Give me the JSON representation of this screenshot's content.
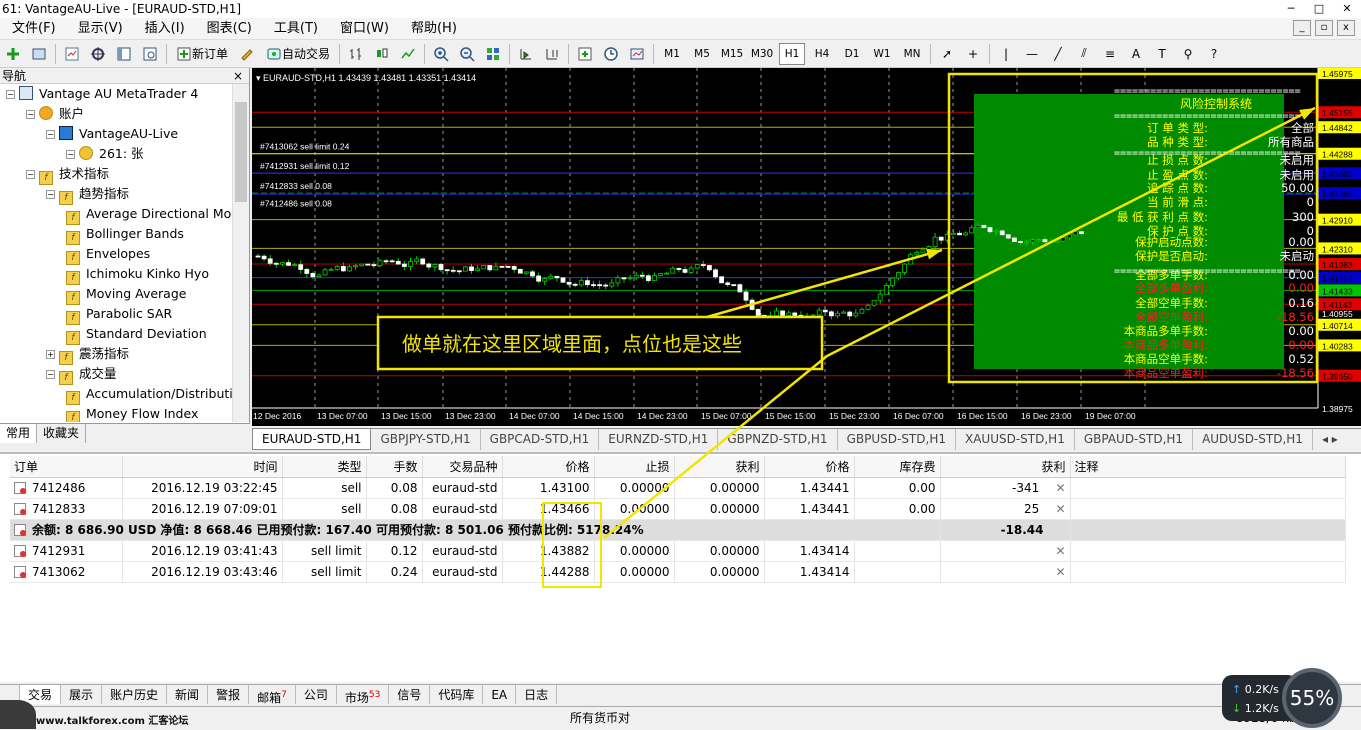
{
  "window": {
    "title": "61: VantageAU-Live - [EURAUD-STD,H1]"
  },
  "menu": [
    "文件(F)",
    "显示(V)",
    "插入(I)",
    "图表(C)",
    "工具(T)",
    "窗口(W)",
    "帮助(H)"
  ],
  "toolbar": {
    "new_order": "新订单",
    "auto_trading": "自动交易",
    "timeframes": [
      "M1",
      "M5",
      "M15",
      "M30",
      "H1",
      "H4",
      "D1",
      "W1",
      "MN"
    ],
    "active_tf": "H1"
  },
  "navigator": {
    "title": "导航",
    "tree": [
      {
        "level": 0,
        "label": "Vantage AU MetaTrader 4",
        "icon": "metatrader-icon"
      },
      {
        "level": 1,
        "label": "账户",
        "icon": "accounts-icon"
      },
      {
        "level": 2,
        "label": "VantageAU-Live",
        "icon": "server-icon"
      },
      {
        "level": 3,
        "label": "261: 张",
        "icon": "user-icon"
      },
      {
        "level": 1,
        "label": "技术指标",
        "icon": "indicator-icon"
      },
      {
        "level": 2,
        "label": "趋势指标",
        "icon": "indicator-icon"
      },
      {
        "level": 3,
        "label": "Average Directional Mo",
        "icon": "indicator-icon"
      },
      {
        "level": 3,
        "label": "Bollinger Bands",
        "icon": "indicator-icon"
      },
      {
        "level": 3,
        "label": "Envelopes",
        "icon": "indicator-icon"
      },
      {
        "level": 3,
        "label": "Ichimoku Kinko Hyo",
        "icon": "indicator-icon"
      },
      {
        "level": 3,
        "label": "Moving Average",
        "icon": "indicator-icon"
      },
      {
        "level": 3,
        "label": "Parabolic SAR",
        "icon": "indicator-icon"
      },
      {
        "level": 3,
        "label": "Standard Deviation",
        "icon": "indicator-icon"
      },
      {
        "level": 2,
        "label": "震荡指标",
        "icon": "indicator-icon"
      },
      {
        "level": 2,
        "label": "成交量",
        "icon": "indicator-icon"
      },
      {
        "level": 3,
        "label": "Accumulation/Distributic",
        "icon": "indicator-icon"
      },
      {
        "level": 3,
        "label": "Money Flow Index",
        "icon": "indicator-icon"
      }
    ],
    "tabs": [
      "常用",
      "收藏夹"
    ]
  },
  "chart": {
    "header": "EURAUD-STD,H1  1.43439 1.43481 1.43351 1.43414",
    "orders": [
      "#7413062 sell limit 0.24",
      "#7412931 sell limit 0.12",
      "#7412833 sell 0.08",
      "#7412486 sell 0.08"
    ],
    "x_labels": [
      "12 Dec 2016",
      "13 Dec 07:00",
      "13 Dec 15:00",
      "13 Dec 23:00",
      "14 Dec 07:00",
      "14 Dec 15:00",
      "14 Dec 23:00",
      "15 Dec 07:00",
      "15 Dec 15:00",
      "15 Dec 23:00",
      "16 Dec 07:00",
      "16 Dec 15:00",
      "16 Dec 23:00",
      "19 Dec 07:00"
    ],
    "price_labels": [
      {
        "text": "1.45155",
        "bg": "#e00000",
        "color": "#000"
      },
      {
        "text": "1.44842",
        "bg": "#ffff00",
        "color": "#000"
      },
      {
        "text": "1.44288",
        "bg": "#ffff00",
        "color": "#000"
      },
      {
        "text": "1.43882",
        "bg": "#0000cc",
        "color": "#000"
      },
      {
        "text": "1.43466",
        "bg": "#0000cc",
        "color": "#000"
      },
      {
        "text": "1.42910",
        "bg": "#ffff00",
        "color": "#000"
      },
      {
        "text": "1.42310",
        "bg": "#ffff00",
        "color": "#000"
      },
      {
        "text": "1.41983",
        "bg": "#e00000",
        "color": "#000"
      },
      {
        "text": "1.41414",
        "bg": "#0000cc",
        "color": "#000"
      },
      {
        "text": "1.41433",
        "bg": "#00c800",
        "color": "#000"
      },
      {
        "text": "1.41143",
        "bg": "#e00000",
        "color": "#000"
      },
      {
        "text": "1.40955",
        "bg": "#000",
        "color": "#fff"
      },
      {
        "text": "1.40714",
        "bg": "#ffff00",
        "color": "#000"
      },
      {
        "text": "1.40283",
        "bg": "#ffff00",
        "color": "#000"
      },
      {
        "text": "1.39650",
        "bg": "#e00000",
        "color": "#000"
      },
      {
        "text": "1.38975",
        "bg": "#000",
        "color": "#fff"
      },
      {
        "text": "1.45975",
        "bg": "#ffff00",
        "color": "#000"
      }
    ],
    "annotation": "做单就在这里区域里面，点位也是这些",
    "risk_panel": {
      "title": "风险控制系统",
      "rows": [
        {
          "label": "订 单 类 型:",
          "value": "全部",
          "color": "#ffff00"
        },
        {
          "label": "品 种 类 型:",
          "value": "所有商品",
          "color": "#ffff00"
        },
        {
          "label": "止 损 点 数:",
          "value": "未启用",
          "color": "#ffff00"
        },
        {
          "label": "止 盈 点 数:",
          "value": "未启用",
          "color": "#ffff00"
        },
        {
          "label": "追 踪 点 数:",
          "value": "50.00",
          "color": "#ffff00"
        },
        {
          "label": "当 前 滑 点:",
          "value": "0",
          "color": "#ffff00"
        },
        {
          "label": "最 低 获 利 点 数:",
          "value": "300",
          "color": "#ffff00"
        },
        {
          "label": "保 护 点 数:",
          "value": "0",
          "color": "#ffff00"
        },
        {
          "label": "保护启动点数:",
          "value": "0.00",
          "color": "#ffff00"
        },
        {
          "label": "保护是否启动:",
          "value": "未启动",
          "color": "#ffff00"
        },
        {
          "label": "全部多单手数:",
          "value": "0.00",
          "color": "#ffff00"
        },
        {
          "label": "全部多单盈利:",
          "value": "0.00",
          "color": "#ff2020"
        },
        {
          "label": "全部空单手数:",
          "value": "0.16",
          "color": "#ffff00"
        },
        {
          "label": "全部空单盈利:",
          "value": "-18.56",
          "color": "#ff2020"
        },
        {
          "label": "本商品多单手数:",
          "value": "0.00",
          "color": "#ffff00"
        },
        {
          "label": "本商品多单盈利:",
          "value": "0.00",
          "color": "#ff2020"
        },
        {
          "label": "本商品空单手数:",
          "value": "0.52",
          "color": "#ffff00"
        },
        {
          "label": "本商品空单盈利:",
          "value": "-18.56",
          "color": "#ff2020"
        }
      ]
    }
  },
  "chart_tabs": [
    "EURAUD-STD,H1",
    "GBPJPY-STD,H1",
    "GBPCAD-STD,H1",
    "EURNZD-STD,H1",
    "GBPNZD-STD,H1",
    "GBPUSD-STD,H1",
    "XAUUSD-STD,H1",
    "GBPAUD-STD,H1",
    "AUDUSD-STD,H1"
  ],
  "terminal": {
    "columns": [
      "订单",
      "时间",
      "类型",
      "手数",
      "交易品种",
      "价格",
      "止损",
      "获利",
      "价格",
      "库存费",
      "获利",
      "注释"
    ],
    "rows": [
      {
        "order": "7412486",
        "time": "2016.12.19 03:22:45",
        "type": "sell",
        "lots": "0.08",
        "symbol": "euraud-std",
        "price": "1.43100",
        "sl": "0.00000",
        "tp": "0.00000",
        "cur": "1.43441",
        "swap": "0.00",
        "profit": "-341"
      },
      {
        "order": "7412833",
        "time": "2016.12.19 07:09:01",
        "type": "sell",
        "lots": "0.08",
        "symbol": "euraud-std",
        "price": "1.43466",
        "sl": "0.00000",
        "tp": "0.00000",
        "cur": "1.43441",
        "swap": "0.00",
        "profit": "25"
      }
    ],
    "summary": {
      "text": "余额: 8 686.90 USD  净值: 8 668.46  已用预付款: 167.40  可用预付款: 8 501.06  预付款比例: 5178.24%",
      "profit": "-18.44"
    },
    "pending": [
      {
        "order": "7412931",
        "time": "2016.12.19 03:41:43",
        "type": "sell limit",
        "lots": "0.12",
        "symbol": "euraud-std",
        "price": "1.43882",
        "sl": "0.00000",
        "tp": "0.00000",
        "cur": "1.43414"
      },
      {
        "order": "7413062",
        "time": "2016.12.19 03:43:46",
        "type": "sell limit",
        "lots": "0.24",
        "symbol": "euraud-std",
        "price": "1.44288",
        "sl": "0.00000",
        "tp": "0.00000",
        "cur": "1.43414"
      }
    ],
    "tabs": [
      {
        "label": "交易",
        "badge": ""
      },
      {
        "label": "展示",
        "badge": ""
      },
      {
        "label": "账户历史",
        "badge": ""
      },
      {
        "label": "新闻",
        "badge": ""
      },
      {
        "label": "警报",
        "badge": ""
      },
      {
        "label": "邮箱",
        "badge": "7"
      },
      {
        "label": "公司",
        "badge": ""
      },
      {
        "label": "市场",
        "badge": "53"
      },
      {
        "label": "信号",
        "badge": ""
      },
      {
        "label": "代码库",
        "badge": ""
      },
      {
        "label": "EA",
        "badge": ""
      },
      {
        "label": "日志",
        "badge": ""
      }
    ]
  },
  "status": {
    "center": "所有货币对",
    "right": "8925/6 kb",
    "watermark": "www.talkforex.com 汇客论坛",
    "up_speed": "0.2K/s",
    "down_speed": "1.2K/s",
    "cpu": "55%"
  }
}
